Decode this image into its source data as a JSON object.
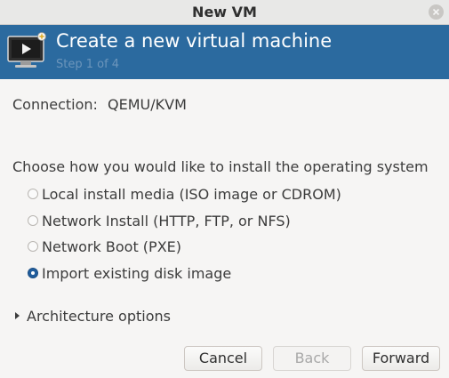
{
  "window": {
    "title": "New VM"
  },
  "header": {
    "title": "Create a new virtual machine",
    "step": "Step 1 of 4",
    "icon": "vm-monitor-icon"
  },
  "connection": {
    "label": "Connection:",
    "value": "QEMU/KVM"
  },
  "install": {
    "question": "Choose how you would like to install the operating system",
    "options": [
      {
        "label": "Local install media (ISO image or CDROM)",
        "checked": false
      },
      {
        "label": "Network Install (HTTP, FTP, or NFS)",
        "checked": false
      },
      {
        "label": "Network Boot (PXE)",
        "checked": false
      },
      {
        "label": "Import existing disk image",
        "checked": true
      }
    ]
  },
  "architecture": {
    "label": "Architecture options",
    "expanded": false
  },
  "buttons": {
    "cancel": "Cancel",
    "back": "Back",
    "forward": "Forward"
  },
  "colors": {
    "header_bg": "#2b6a9f",
    "accent": "#215d9c"
  }
}
